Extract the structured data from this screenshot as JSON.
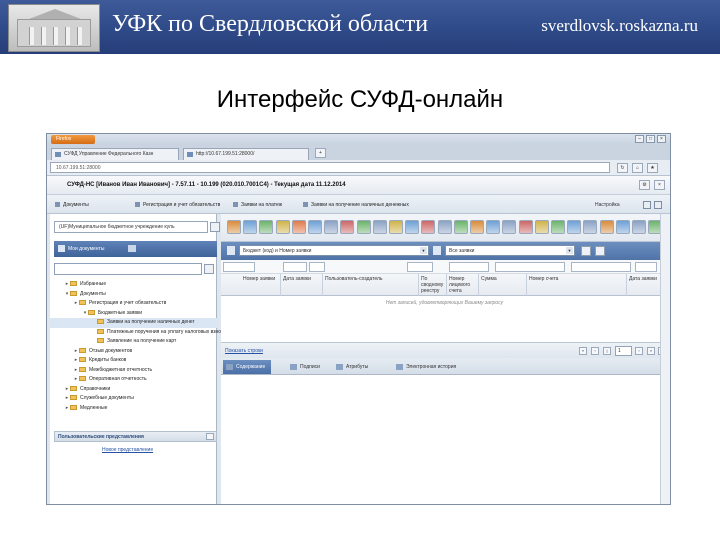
{
  "header": {
    "title": "УФК по Свердловской области",
    "site": "sverdlovsk.roskazna.ru"
  },
  "slide_title": "Интерфейс СУФД-онлайн",
  "browser": {
    "menu_button": "Firefox",
    "tabs": [
      {
        "label": "СУФД Управление Федерального Казн"
      },
      {
        "label": "http://10.67.199.51:28000/"
      }
    ],
    "url": "10.67.199.51:28000"
  },
  "app": {
    "title": "СУФД-НС [Иванов Иван Иванович] - 7.57.11 - 10.199 (020.010.7001С4) - Текущая дата 11.12.2014",
    "menu": [
      "Документы",
      "Регистрация и учет обязательств",
      "Заявки на платеж",
      "Заявки на получение наличных денежных"
    ],
    "settings_label": "Настройка"
  },
  "left_panel": {
    "org_select": "(UF)Муниципальное бюджетное учреждение куль",
    "doc_tab": "Мои документы",
    "tree": [
      {
        "label": "Избранные",
        "level": 0,
        "arrow": "▸"
      },
      {
        "label": "Документы",
        "level": 0,
        "arrow": "▾"
      },
      {
        "label": "Регистрация и учет обязательств",
        "level": 1,
        "arrow": "▸"
      },
      {
        "label": "Бюджетные заявки",
        "level": 2,
        "arrow": "▾"
      },
      {
        "label": "Заявки на получение наличных денег",
        "level": 3,
        "arrow": "",
        "selected": true
      },
      {
        "label": "Платежные поручения на уплату налоговых взносов",
        "level": 3,
        "arrow": ""
      },
      {
        "label": "Заявление на получение карт",
        "level": 3,
        "arrow": ""
      },
      {
        "label": "Отзыв документов",
        "level": 1,
        "arrow": "▸"
      },
      {
        "label": "Кредиты банков",
        "level": 1,
        "arrow": "▸"
      },
      {
        "label": "Межбюджетная отчетность",
        "level": 1,
        "arrow": "▸"
      },
      {
        "label": "Оперативная отчетность",
        "level": 1,
        "arrow": "▸"
      },
      {
        "label": "Справочники",
        "level": 0,
        "arrow": "▸"
      },
      {
        "label": "Служебные документы",
        "level": 0,
        "arrow": "▸"
      },
      {
        "label": "Медленные",
        "level": 0,
        "arrow": "▸"
      }
    ],
    "favorites_title": "Пользовательские представления",
    "new_view_link": "Новое представление"
  },
  "grid": {
    "filter_left": "Бюджет (код) и Номер заявки",
    "filter_right": "Все заявки",
    "columns": [
      "Номер заявки",
      "Дата заявки",
      "Пользователь-создатель",
      "По сводному реестру",
      "Номер лицевого счета",
      "Сумма",
      "Номер счета",
      "Дата заявки"
    ],
    "empty_message": "Нет записей, удовлетворяющих Вашему запросу",
    "show_all": "Показать строки",
    "page": "1",
    "bottom_tabs": [
      "Содержание",
      "Подписи",
      "Атрибуты",
      "Электронная история"
    ]
  }
}
